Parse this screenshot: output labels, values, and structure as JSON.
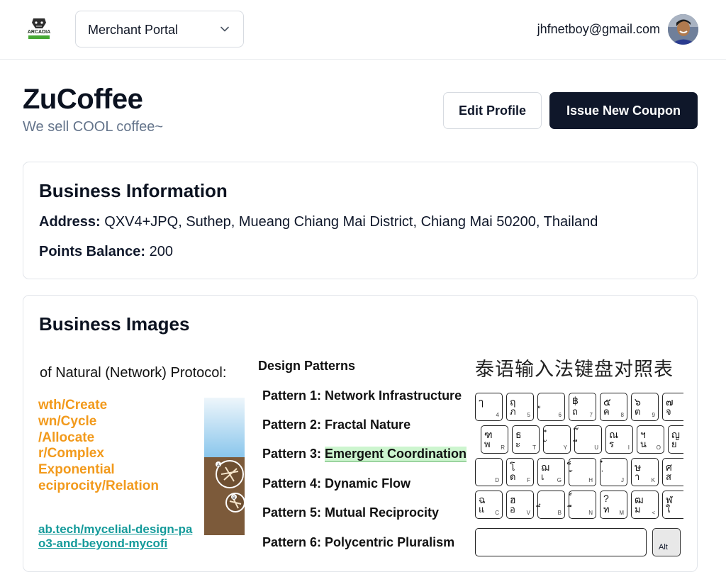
{
  "header": {
    "portal_selector": {
      "value": "Merchant Portal"
    },
    "user_email": "jhfnetboy@gmail.com",
    "logo_text": "ARCADIA"
  },
  "merchant": {
    "name": "ZuCoffee",
    "tagline": "We sell COOL coffee~"
  },
  "actions": {
    "edit_profile": "Edit Profile",
    "issue_coupon": "Issue New Coupon"
  },
  "business_info": {
    "title": "Business Information",
    "address_label": "Address:",
    "address_value": "QXV4+JPQ, Suthep, Mueang Chiang Mai District, Chiang Mai 50200, Thailand",
    "points_label": "Points Balance:",
    "points_value": "200"
  },
  "business_images": {
    "title": "Business Images",
    "image1": {
      "heading": "of Natural (Network) Protocol:",
      "lines": [
        "wth/Create",
        "wn/Cycle",
        "/Allocate",
        "r/Complex",
        "Exponential",
        "eciprocity/Relation"
      ],
      "links": [
        "ab.tech/mycelial-design-pa",
        "o3-and-beyond-mycofi"
      ]
    },
    "image2": {
      "heading": "Design Patterns",
      "patterns": [
        {
          "prefix": "Pattern 1: ",
          "name": "Network Infrastructure"
        },
        {
          "prefix": "Pattern 2: ",
          "name": "Fractal Nature"
        },
        {
          "prefix": "Pattern 3: ",
          "name": "Emergent Coordination"
        },
        {
          "prefix": "Pattern 4: ",
          "name": "Dynamic Flow"
        },
        {
          "prefix": "Pattern 5: ",
          "name": "Mutual Reciprocity"
        },
        {
          "prefix": "Pattern 6: ",
          "name": "Polycentric Pluralism"
        }
      ]
    },
    "image3": {
      "heading": "泰语输入法键盘对照表",
      "alt_key": "Alt",
      "rows": [
        [
          {
            "t": "ๅ",
            "s": "4"
          },
          {
            "t": "ฤ",
            "b": "ภ",
            "s": "5"
          },
          {
            "t": "ู",
            "s": "6"
          },
          {
            "t": "฿",
            "b": "ถ",
            "s": "7"
          },
          {
            "t": "๕",
            "b": "ค",
            "s": "8"
          },
          {
            "t": "๖",
            "b": "ต",
            "s": "9"
          },
          {
            "t": "๗",
            "b": "จ"
          }
        ],
        [
          {
            "t": "ฑ",
            "b": "พ",
            "s": "R"
          },
          {
            "t": "ธ",
            "b": "ะ",
            "s": "T"
          },
          {
            "t": "ํ",
            "b": "ั",
            "s": "Y"
          },
          {
            "t": "๊",
            "b": "ี",
            "s": "U"
          },
          {
            "t": "ณ",
            "b": "ร",
            "s": "I"
          },
          {
            "t": "ฯ",
            "b": "น",
            "s": "O"
          },
          {
            "t": "ญ",
            "b": "ย"
          }
        ],
        [
          {
            "t": "",
            "b": "",
            "s": "D"
          },
          {
            "t": "โ",
            "b": "ด",
            "s": "F"
          },
          {
            "t": "ฌ",
            "b": "เ",
            "s": "G"
          },
          {
            "t": "็",
            "b": "้",
            "s": "H"
          },
          {
            "t": "๋",
            "b": "่",
            "s": "J"
          },
          {
            "t": "ษ",
            "b": "า",
            "s": "K"
          },
          {
            "t": "ศ",
            "b": "ส"
          }
        ],
        [
          {
            "t": "ฉ",
            "b": "แ",
            "s": "C"
          },
          {
            "t": "ฮ",
            "b": "อ",
            "s": "V"
          },
          {
            "t": "ฺ",
            "b": "ิ",
            "s": "B"
          },
          {
            "t": "์",
            "b": "ื",
            "s": "N"
          },
          {
            "t": "?",
            "b": "ท",
            "s": "M"
          },
          {
            "t": "ฒ",
            "b": "ม",
            "s": "<"
          },
          {
            "t": "ฬ",
            "b": "ใ"
          }
        ]
      ]
    }
  }
}
